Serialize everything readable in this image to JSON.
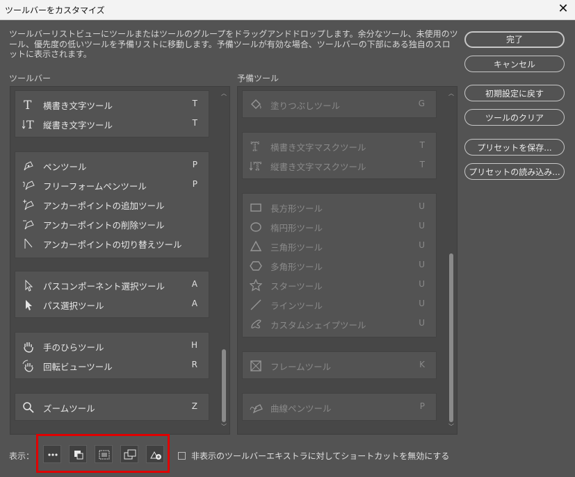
{
  "window": {
    "title": "ツールバーをカスタマイズ",
    "close_glyph": "✕"
  },
  "description": "ツールバーリストビューにツールまたはツールのグループをドラッグアンドドロップします。余分なツール、未使用のツール、優先度の低いツールを予備リストに移動します。予備ツールが有効な場合、ツールバーの下部にある独自のスロットに表示されます。",
  "toolbar_panel": {
    "label": "ツールバー",
    "groups": [
      {
        "tools": [
          {
            "name": "横書き文字ツール",
            "key": "T",
            "icon": "horizontal-type-icon"
          },
          {
            "name": "縦書き文字ツール",
            "key": "T",
            "icon": "vertical-type-icon"
          }
        ]
      },
      {
        "tools": [
          {
            "name": "ペンツール",
            "key": "P",
            "icon": "pen-icon"
          },
          {
            "name": "フリーフォームペンツール",
            "key": "P",
            "icon": "freeform-pen-icon"
          },
          {
            "name": "アンカーポイントの追加ツール",
            "key": "",
            "icon": "add-anchor-icon"
          },
          {
            "name": "アンカーポイントの削除ツール",
            "key": "",
            "icon": "delete-anchor-icon"
          },
          {
            "name": "アンカーポイントの切り替えツール",
            "key": "",
            "icon": "convert-point-icon"
          }
        ]
      },
      {
        "tools": [
          {
            "name": "パスコンポーネント選択ツール",
            "key": "A",
            "icon": "path-selection-icon"
          },
          {
            "name": "パス選択ツール",
            "key": "A",
            "icon": "direct-selection-icon"
          }
        ]
      },
      {
        "tools": [
          {
            "name": "手のひらツール",
            "key": "H",
            "icon": "hand-icon"
          },
          {
            "name": "回転ビューツール",
            "key": "R",
            "icon": "rotate-view-icon"
          }
        ]
      },
      {
        "tools": [
          {
            "name": "ズームツール",
            "key": "Z",
            "icon": "zoom-icon"
          }
        ]
      }
    ]
  },
  "extra_panel": {
    "label": "予備ツール",
    "groups": [
      {
        "tools": [
          {
            "name": "塗りつぶしツール",
            "key": "G",
            "icon": "paint-bucket-icon"
          }
        ]
      },
      {
        "tools": [
          {
            "name": "横書き文字マスクツール",
            "key": "T",
            "icon": "horizontal-type-mask-icon"
          },
          {
            "name": "縦書き文字マスクツール",
            "key": "T",
            "icon": "vertical-type-mask-icon"
          }
        ]
      },
      {
        "tools": [
          {
            "name": "長方形ツール",
            "key": "U",
            "icon": "rectangle-icon"
          },
          {
            "name": "楕円形ツール",
            "key": "U",
            "icon": "ellipse-icon"
          },
          {
            "name": "三角形ツール",
            "key": "U",
            "icon": "triangle-icon"
          },
          {
            "name": "多角形ツール",
            "key": "U",
            "icon": "polygon-icon"
          },
          {
            "name": "スターツール",
            "key": "U",
            "icon": "star-icon"
          },
          {
            "name": "ラインツール",
            "key": "U",
            "icon": "line-icon"
          },
          {
            "name": "カスタムシェイプツール",
            "key": "U",
            "icon": "custom-shape-icon"
          }
        ]
      },
      {
        "tools": [
          {
            "name": "フレームツール",
            "key": "K",
            "icon": "frame-icon"
          }
        ]
      },
      {
        "tools": [
          {
            "name": "曲線ペンツール",
            "key": "P",
            "icon": "curvature-pen-icon"
          }
        ]
      }
    ]
  },
  "buttons": {
    "done": "完了",
    "cancel": "キャンセル",
    "restore_defaults": "初期設定に戻す",
    "clear_tools": "ツールのクリア",
    "save_preset": "プリセットを保存...",
    "load_preset": "プリセットの読み込み..."
  },
  "bottom": {
    "show_label": "表示：",
    "display_icons": [
      "more-icon",
      "swap-color-icon",
      "quick-mask-icon",
      "screen-mode-icon",
      "extra-tools-icon"
    ],
    "checkbox_label": "非表示のツールバーエキストラに対してショートカットを無効にする",
    "checkbox_checked": false
  },
  "colors": {
    "background": "#535353",
    "panel": "#474747",
    "highlight": "#e00000"
  }
}
